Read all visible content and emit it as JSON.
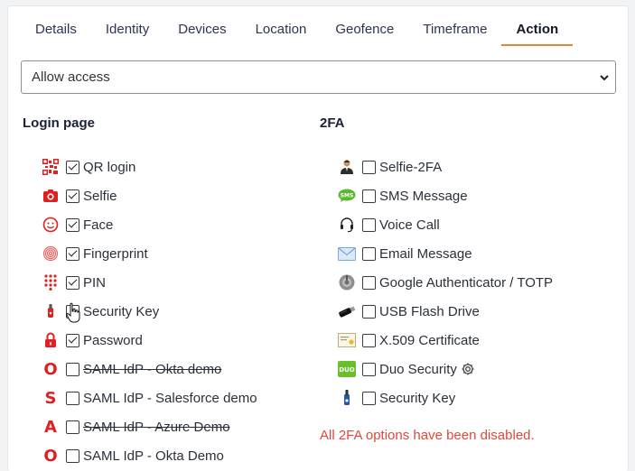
{
  "tabs": [
    {
      "label": "Details",
      "active": false
    },
    {
      "label": "Identity",
      "active": false
    },
    {
      "label": "Devices",
      "active": false
    },
    {
      "label": "Location",
      "active": false
    },
    {
      "label": "Geofence",
      "active": false
    },
    {
      "label": "Timeframe",
      "active": false
    },
    {
      "label": "Action",
      "active": true
    }
  ],
  "action_select": {
    "value": "Allow access"
  },
  "login": {
    "heading": "Login page",
    "items": [
      {
        "label": "QR login",
        "icon": "qr-code-icon",
        "checked": true,
        "strike": false
      },
      {
        "label": "Selfie",
        "icon": "camera-icon",
        "checked": true,
        "strike": false
      },
      {
        "label": "Face",
        "icon": "face-icon",
        "checked": true,
        "strike": false
      },
      {
        "label": "Fingerprint",
        "icon": "fingerprint-icon",
        "checked": true,
        "strike": false
      },
      {
        "label": "PIN",
        "icon": "keypad-icon",
        "checked": true,
        "strike": false
      },
      {
        "label": "Security Key",
        "icon": "security-key-icon",
        "checked": false,
        "strike": false
      },
      {
        "label": "Password",
        "icon": "padlock-icon",
        "checked": true,
        "strike": false
      },
      {
        "label": "SAML IdP - Okta demo",
        "icon": "okta-icon",
        "letter": "O",
        "checked": false,
        "strike": true
      },
      {
        "label": "SAML IdP - Salesforce demo",
        "icon": "salesforce-icon",
        "letter": "S",
        "checked": false,
        "strike": false
      },
      {
        "label": "SAML IdP - Azure Demo",
        "icon": "azure-icon",
        "letter": "A",
        "checked": false,
        "strike": true
      },
      {
        "label": "SAML IdP - Okta Demo",
        "icon": "okta-icon",
        "letter": "O",
        "checked": false,
        "strike": false
      }
    ]
  },
  "twofa": {
    "heading": "2FA",
    "items": [
      {
        "label": "Selfie-2FA",
        "icon": "person-icon",
        "checked": false
      },
      {
        "label": "SMS Message",
        "icon": "sms-icon",
        "checked": false
      },
      {
        "label": "Voice Call",
        "icon": "headset-icon",
        "checked": false
      },
      {
        "label": "Email Message",
        "icon": "envelope-icon",
        "checked": false
      },
      {
        "label": "Google Authenticator / TOTP",
        "icon": "authenticator-icon",
        "checked": false
      },
      {
        "label": "USB Flash Drive",
        "icon": "usb-drive-icon",
        "checked": false
      },
      {
        "label": "X.509 Certificate",
        "icon": "certificate-icon",
        "checked": false
      },
      {
        "label": "Duo Security",
        "icon": "duo-icon",
        "checked": false,
        "gear": true
      },
      {
        "label": "Security Key",
        "icon": "security-key-icon",
        "checked": false
      }
    ],
    "warning": "All 2FA options have been disabled."
  },
  "colors": {
    "accent": "#e8833a",
    "warning": "#e0483a",
    "brand_red": "#e02020"
  }
}
